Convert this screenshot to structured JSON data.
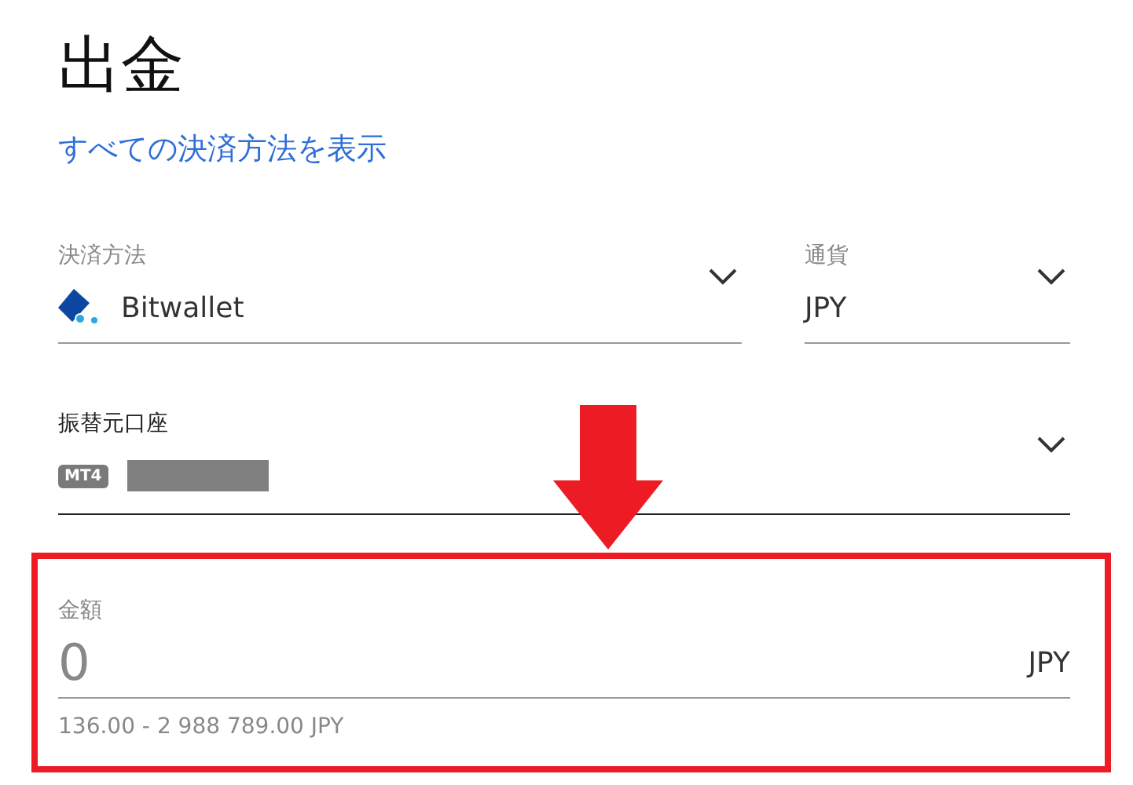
{
  "title": "出金",
  "link": "すべての決済方法を表示",
  "payment_method": {
    "label": "決済方法",
    "value": "Bitwallet"
  },
  "currency": {
    "label": "通貨",
    "value": "JPY"
  },
  "account": {
    "label": "振替元口座",
    "badge": "MT4"
  },
  "amount": {
    "label": "金額",
    "placeholder": "0",
    "unit": "JPY",
    "hint": "136.00 - 2 988 789.00 JPY"
  }
}
